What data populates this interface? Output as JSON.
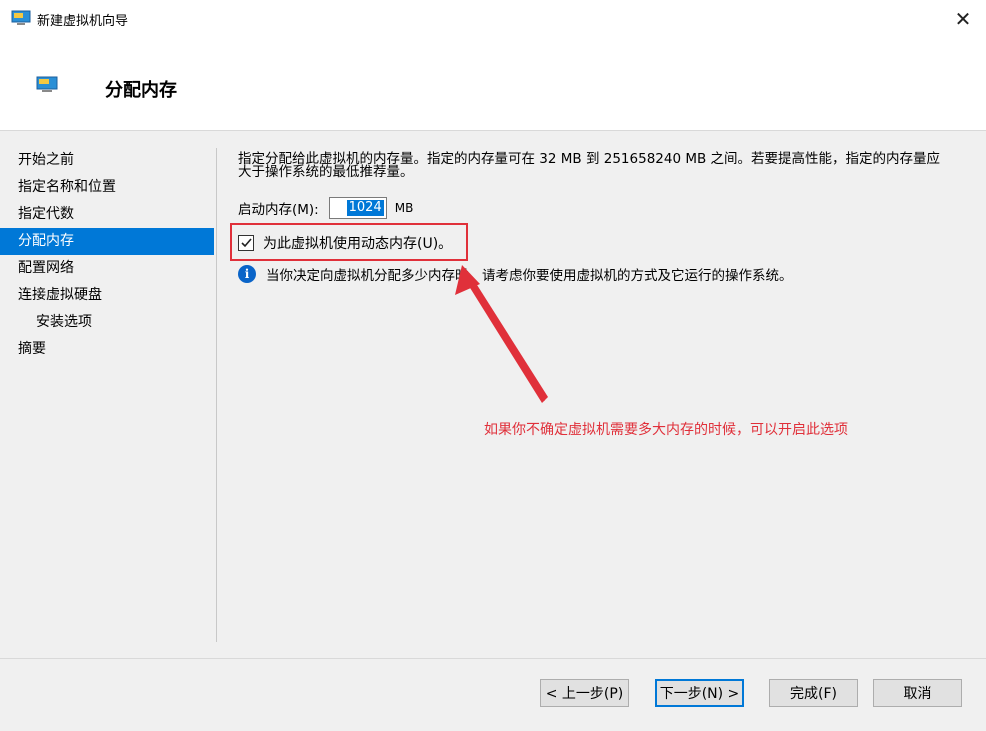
{
  "window": {
    "title": "新建虚拟机向导",
    "close_glyph": "✕"
  },
  "header": {
    "title": "分配内存"
  },
  "nav": {
    "items": [
      {
        "label": "开始之前",
        "sub": false,
        "selected": false
      },
      {
        "label": "指定名称和位置",
        "sub": false,
        "selected": false
      },
      {
        "label": "指定代数",
        "sub": false,
        "selected": false
      },
      {
        "label": "分配内存",
        "sub": false,
        "selected": true
      },
      {
        "label": "配置网络",
        "sub": false,
        "selected": false
      },
      {
        "label": "连接虚拟硬盘",
        "sub": false,
        "selected": false
      },
      {
        "label": "安装选项",
        "sub": true,
        "selected": false
      },
      {
        "label": "摘要",
        "sub": false,
        "selected": false
      }
    ]
  },
  "main": {
    "description": "指定分配给此虚拟机的内存量。指定的内存量可在 32 MB 到 251658240 MB 之间。若要提高性能，指定的内存量应大于操作系统的最低推荐量。",
    "startup_label": "启动内存(M):",
    "startup_value": "1024",
    "startup_unit": "MB",
    "dynamic_memory_label": "为此虚拟机使用动态内存(U)。",
    "dynamic_memory_checked": true,
    "info_icon": "info-icon",
    "info_text": "当你决定向虚拟机分配多少内存时，请考虑你要使用虚拟机的方式及它运行的操作系统。"
  },
  "annotation": {
    "text": "如果你不确定虚拟机需要多大内存的时候，可以开启此选项",
    "color": "#e0303a"
  },
  "footer": {
    "prev_label": "< 上一步(P)",
    "next_label": "下一步(N) >",
    "finish_label": "完成(F)",
    "cancel_label": "取消"
  },
  "colors": {
    "accent": "#0078d7",
    "annotation_red": "#e0303a",
    "panel_bg": "#f0f0f0"
  }
}
